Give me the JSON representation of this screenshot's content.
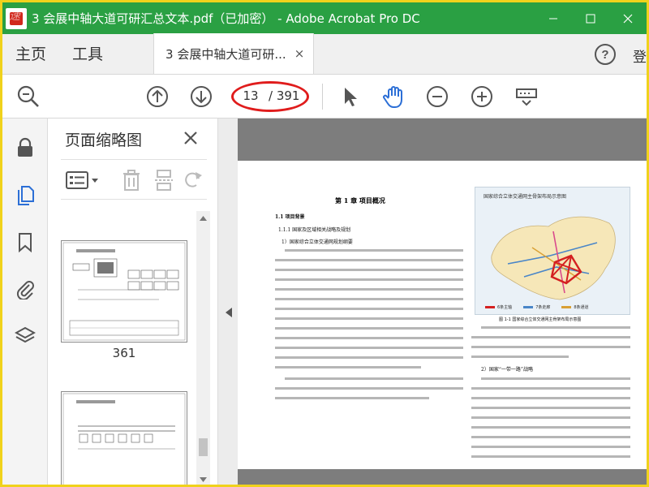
{
  "window": {
    "title": "3 会展中轴大道可研汇总文本.pdf（已加密） - Adobe Acrobat Pro DC",
    "watermark": "速"
  },
  "menu": {
    "home": "主页",
    "tools": "工具"
  },
  "tab": {
    "label": "3 会展中轴大道可研...",
    "close": "×"
  },
  "header_right_cut": "登",
  "toolbar": {
    "current_page": "13",
    "total_pages": "/ 391"
  },
  "thumbnails": {
    "title": "页面缩略图",
    "pages": [
      {
        "label": "361"
      }
    ]
  },
  "document": {
    "chapter": "第 1 章   项目概况",
    "h1": "1.1  项目背景",
    "h2": "1.1.1  国家及区域相关战略及规划",
    "h3": "1）国家综合立体交通网规划纲要",
    "h4": "2）国家“一带一路”战略",
    "map_title": "国家综合立体交通网主骨架布局示意图",
    "map_caption": "图 1-1  国家综合立体交通网主骨架布局示意图",
    "legend": [
      "6条主轴",
      "7条走廊",
      "8条通道"
    ]
  },
  "colors": {
    "titlebar": "#2aa043",
    "highlight": "#e01c1c",
    "border": "#f0d21c"
  }
}
